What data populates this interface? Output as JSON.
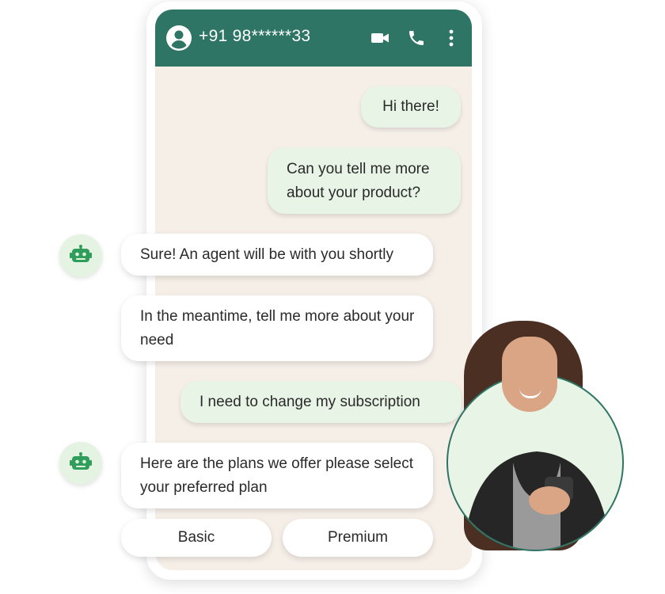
{
  "header": {
    "phone_number": "+91 98******33",
    "icons": [
      "avatar-icon",
      "video-icon",
      "call-icon",
      "more-vert-icon"
    ],
    "background_color": "#2e7566"
  },
  "messages": [
    {
      "sender": "user",
      "text": "Hi there!"
    },
    {
      "sender": "user",
      "text": "Can you tell me more about your product?"
    },
    {
      "sender": "bot",
      "text": "Sure! An agent will be with you shortly"
    },
    {
      "sender": "bot",
      "text": "In the meantime, tell me more about your need"
    },
    {
      "sender": "user",
      "text": "I need to change my subscription"
    },
    {
      "sender": "bot",
      "text": "Here are the plans we offer please select your preferred plan"
    }
  ],
  "options": [
    {
      "label": "Basic"
    },
    {
      "label": "Premium"
    }
  ],
  "colors": {
    "chat_background": "#f6efe8",
    "user_bubble": "#e8f4e5",
    "bot_bubble": "#ffffff",
    "bot_avatar": "#e5f3e2",
    "bot_icon": "#2e9e5a"
  }
}
